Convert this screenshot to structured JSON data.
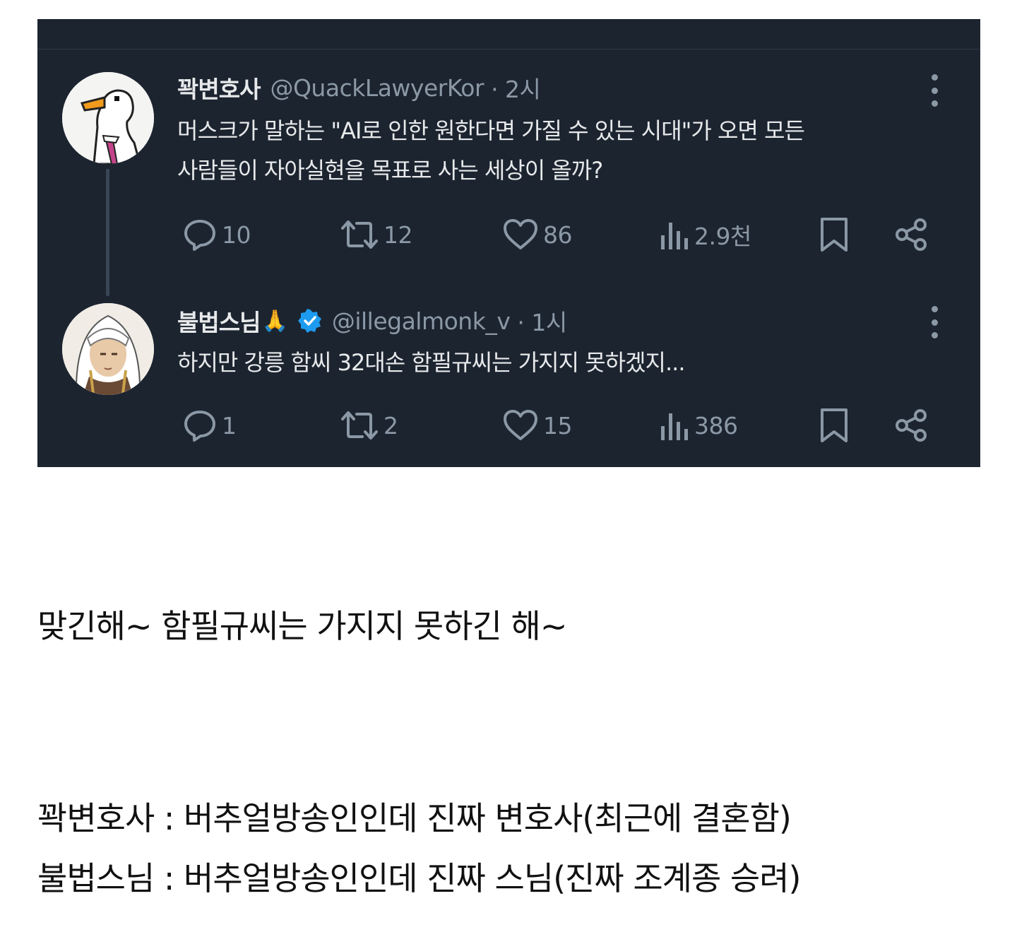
{
  "tweets": [
    {
      "name": "꽉변호사",
      "emoji": "",
      "verified": false,
      "handle": "@QuackLawyerKor",
      "time": "· 2시",
      "text_line1": "머스크가 말하는 \"AI로 인한 원한다면 가질 수 있는 시대\"가 오면 모든",
      "text_line2": "사람들이 자아실현을 목표로 사는 세상이 올까?",
      "replies": "10",
      "retweets": "12",
      "likes": "86",
      "views": "2.9천"
    },
    {
      "name": "불법스님",
      "emoji": "🙏",
      "verified": true,
      "handle": "@illegalmonk_v",
      "time": "· 1시",
      "text_line1": "하지만 강릉 함씨 32대손 함필규씨는 가지지 못하겠지...",
      "replies": "1",
      "retweets": "2",
      "likes": "15",
      "views": "386"
    }
  ],
  "captions": {
    "line1": "맞긴해~ 함필규씨는 가지지 못하긴 해~",
    "line2": "꽉변호사 : 버추얼방송인인데 진짜 변호사(최근에 결혼함)",
    "line3": "불법스님 : 버추얼방송인인데 진짜 스님(진짜 조계종 승려)"
  },
  "colors": {
    "panel_bg": "#1c2430",
    "text_primary": "#e7e9ea",
    "text_secondary": "#8b98a5",
    "verified_blue": "#1d9bf0"
  }
}
